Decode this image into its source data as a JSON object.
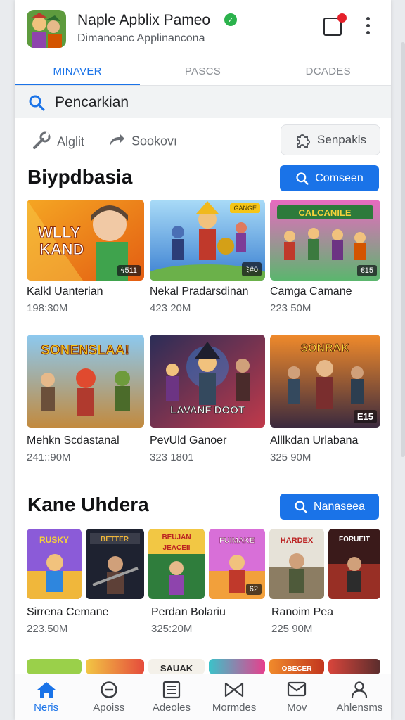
{
  "header": {
    "title": "Naple Apblix Pameo",
    "subtitle": "Dimanoanc Applinancona"
  },
  "tabs": [
    {
      "label": "MINAVER",
      "active": true
    },
    {
      "label": "PASCS",
      "active": false
    },
    {
      "label": "DCADES",
      "active": false
    }
  ],
  "search": {
    "label": "Pencarkian"
  },
  "filters": [
    {
      "label": "Alglit",
      "icon": "wrench-icon"
    },
    {
      "label": "Sookovı",
      "icon": "share-arrow-icon"
    }
  ],
  "chip_button": {
    "label": "Senpakls",
    "icon": "puzzle-icon"
  },
  "sections": [
    {
      "title": "Biypdbasia",
      "button": "Comseen",
      "cards": [
        {
          "name": "Kalkl Uanterian",
          "meta": "198:30M",
          "badge": "ϟ511",
          "thumb_text": "WLLY KAND",
          "colors": [
            "#f5a623",
            "#e35d12"
          ]
        },
        {
          "name": "Nekal Pradarsdinan",
          "meta": "423 20M",
          "badge": "ﾐ#0",
          "tag": "GANGE",
          "colors": [
            "#7ec3f0",
            "#3a7fd1"
          ]
        },
        {
          "name": "Camga Camane",
          "meta": "223 50M",
          "badge": "€15",
          "thumb_text": "CALCANILE",
          "colors": [
            "#e86ac0",
            "#5bb66e"
          ]
        }
      ]
    },
    {
      "cards": [
        {
          "name": "Mehkn Scdastanal",
          "meta": "241::90M",
          "thumb_text": "SONENSLAA!",
          "colors": [
            "#7ab8e6",
            "#c28a3e"
          ]
        },
        {
          "name": "PevUld Ganoer",
          "meta": "323 1801",
          "thumb_text": "LAVANF DOOT",
          "colors": [
            "#2a2d57",
            "#c0394a"
          ]
        },
        {
          "name": "Alllkdan Urlabana",
          "meta": "325 90M",
          "badge": "E15",
          "thumb_text": "SONRAK",
          "colors": [
            "#f08a2b",
            "#3b2a3e"
          ]
        }
      ]
    },
    {
      "title": "Kane Uhdera",
      "button": "Nanaseea",
      "cards": [
        {
          "name": "Sirrena Cemane",
          "meta": "223.50M",
          "wide": false
        }
      ]
    }
  ],
  "third_row": [
    {
      "name": "Sirrena Cemane",
      "meta": "223.50M"
    },
    {
      "name": "Perdan Bolariu",
      "meta": "325:20M"
    },
    {
      "name": "Ranoim Pea",
      "meta": "225 90M"
    }
  ],
  "third_thumbs": [
    {
      "text": "RUSKY",
      "colors": [
        "#8b5bd8",
        "#f0b73b"
      ]
    },
    {
      "text": "BETTER",
      "colors": [
        "#3a3d4a",
        "#1e2230"
      ]
    },
    {
      "text": "BEUJAN JEACEII",
      "colors": [
        "#2f7d3c",
        "#f2c744"
      ]
    },
    {
      "text": "FUIMAKE",
      "colors": [
        "#d86fd8",
        "#f2a03b"
      ],
      "badge": "62"
    },
    {
      "text": "HARDEX",
      "colors": [
        "#e6e2d8",
        "#8c7d63"
      ]
    },
    {
      "text": "FORUEIT",
      "colors": [
        "#3a1a1a",
        "#c0392b"
      ]
    }
  ],
  "fourth_thumbs": [
    {
      "colors": [
        "#9ad04a",
        "#5a8d2d"
      ]
    },
    {
      "colors": [
        "#f2c744",
        "#e54b3c"
      ]
    },
    {
      "text": "SAUAK",
      "colors": [
        "#f4f1ea",
        "#2a2a2a"
      ]
    },
    {
      "colors": [
        "#3ac3c9",
        "#e73f8d"
      ]
    },
    {
      "text": "OBECER",
      "colors": [
        "#f08a2b",
        "#c2361e"
      ]
    },
    {
      "colors": [
        "#d9453b",
        "#5a2d2d"
      ]
    }
  ],
  "bottom_nav": [
    {
      "label": "Neris",
      "icon": "home-icon",
      "active": true
    },
    {
      "label": "Apoiss",
      "icon": "clock-icon",
      "active": false
    },
    {
      "label": "Adeoles",
      "icon": "list-icon",
      "active": false
    },
    {
      "label": "Mormdes",
      "icon": "bowtie-icon",
      "active": false
    },
    {
      "label": "Mov",
      "icon": "mail-icon",
      "active": false
    },
    {
      "label": "Ahlensms",
      "icon": "person-icon",
      "active": false
    }
  ],
  "colors": {
    "accent": "#1a73e8",
    "verified": "#2bb24c",
    "notification": "#e5202a"
  }
}
